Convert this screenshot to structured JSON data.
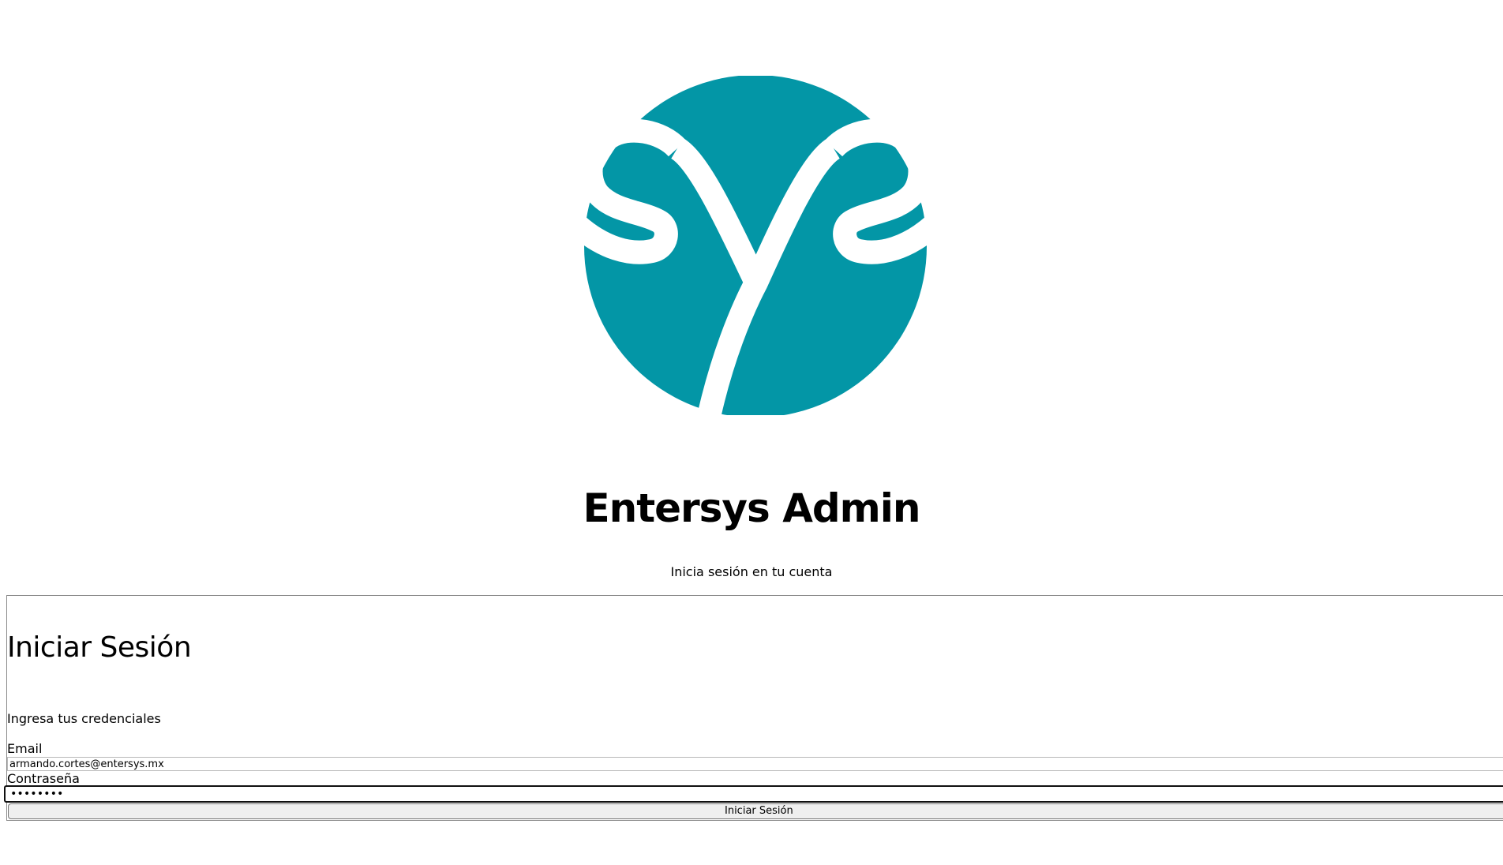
{
  "brand": {
    "logo_icon": "entersys-sys-logo-icon",
    "logo_color": "#0396A6",
    "app_title": "Entersys Admin",
    "subtitle": "Inicia sesión en tu cuenta"
  },
  "login_card": {
    "title": "Iniciar Sesión",
    "description": "Ingresa tus credenciales",
    "email_label": "Email",
    "email_value": "armando.cortes@entersys.mx",
    "password_label": "Contraseña",
    "password_value": "••••••••",
    "submit_label": "Iniciar Sesión"
  }
}
